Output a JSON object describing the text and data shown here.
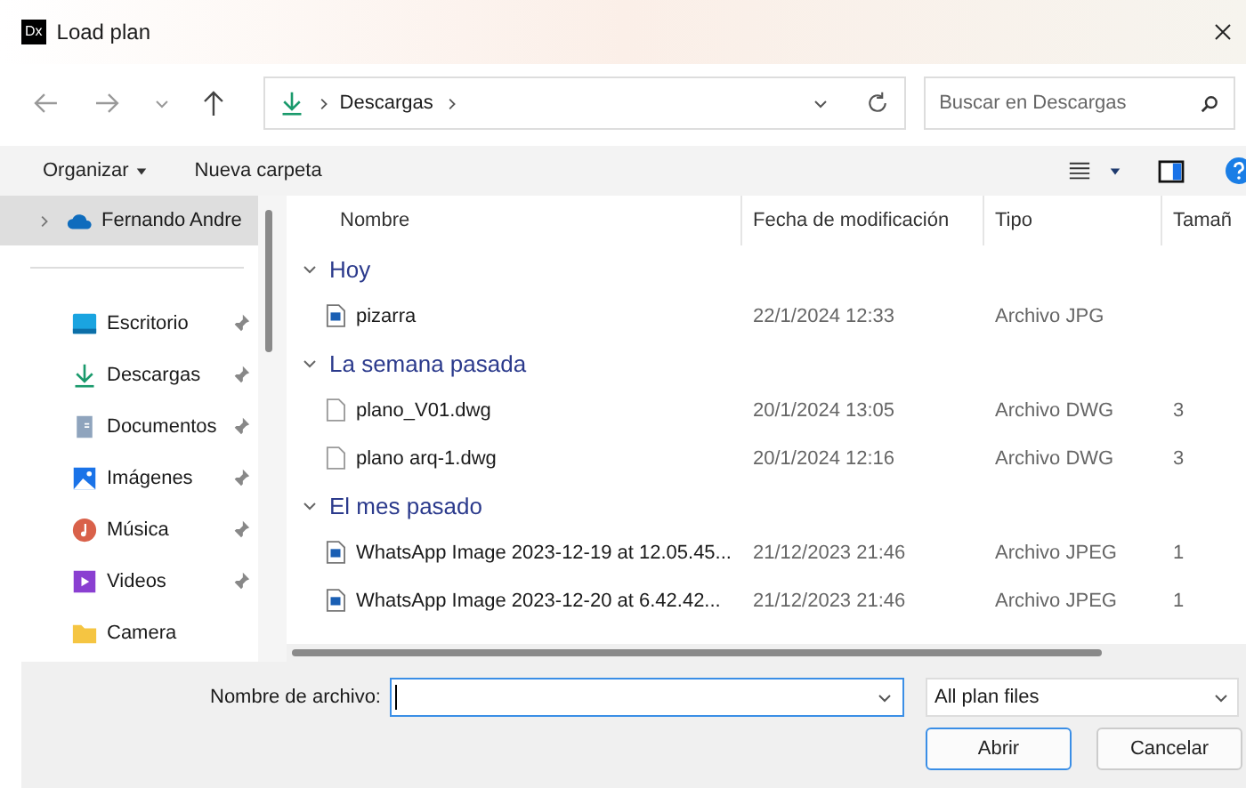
{
  "window": {
    "title": "Load plan",
    "app_badge": "Dx"
  },
  "nav": {
    "path": [
      "Descargas"
    ],
    "search_placeholder": "Buscar en Descargas"
  },
  "toolbar": {
    "organize": "Organizar",
    "new_folder": "Nueva carpeta"
  },
  "sidebar": {
    "items": [
      {
        "label": "Fernando Andre",
        "kind": "cloud",
        "selected": true,
        "pinned": false,
        "expandable": true
      },
      {
        "label": "Escritorio",
        "kind": "desktop",
        "selected": false,
        "pinned": true,
        "expandable": false
      },
      {
        "label": "Descargas",
        "kind": "download",
        "selected": false,
        "pinned": true,
        "expandable": false
      },
      {
        "label": "Documentos",
        "kind": "documents",
        "selected": false,
        "pinned": true,
        "expandable": false
      },
      {
        "label": "Imágenes",
        "kind": "pictures",
        "selected": false,
        "pinned": true,
        "expandable": false
      },
      {
        "label": "Música",
        "kind": "music",
        "selected": false,
        "pinned": true,
        "expandable": false
      },
      {
        "label": "Videos",
        "kind": "videos",
        "selected": false,
        "pinned": true,
        "expandable": false
      },
      {
        "label": "Camera",
        "kind": "folder",
        "selected": false,
        "pinned": false,
        "expandable": false
      }
    ]
  },
  "columns": [
    "Nombre",
    "Fecha de modificación",
    "Tipo",
    "Tamañ"
  ],
  "groups": [
    {
      "label": "Hoy",
      "expanded": true,
      "files": [
        {
          "name": "pizarra",
          "date": "22/1/2024 12:33",
          "type": "Archivo JPG",
          "kind": "image"
        }
      ]
    },
    {
      "label": "La semana pasada",
      "expanded": true,
      "files": [
        {
          "name": "plano_V01.dwg",
          "date": "20/1/2024 13:05",
          "type": "Archivo DWG",
          "size": "3",
          "kind": "document"
        },
        {
          "name": "plano arq-1.dwg",
          "date": "20/1/2024 12:16",
          "type": "Archivo DWG",
          "size": "3",
          "kind": "document"
        }
      ]
    },
    {
      "label": "El mes pasado",
      "expanded": true,
      "files": [
        {
          "name": "WhatsApp Image 2023-12-19 at 12.05.45...",
          "date": "21/12/2023 21:46",
          "type": "Archivo JPEG",
          "size": "1",
          "kind": "image"
        },
        {
          "name": "WhatsApp Image 2023-12-20 at 6.42.42...",
          "date": "21/12/2023 21:46",
          "type": "Archivo JPEG",
          "size": "1",
          "kind": "image"
        }
      ]
    }
  ],
  "footer": {
    "filename_label": "Nombre de archivo:",
    "filter": "All plan files",
    "buttons": [
      {
        "label": "Abrir",
        "default": true
      },
      {
        "label": "Cancelar",
        "default": false
      }
    ]
  }
}
